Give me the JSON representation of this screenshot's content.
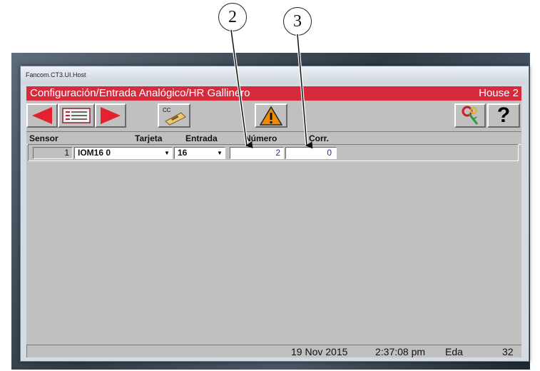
{
  "window": {
    "title": "Fancom.CT3.UI.Host"
  },
  "header": {
    "title": "Configuración/Entrada Analógico/HR Gallinero",
    "house": "House 2"
  },
  "toolbar": {
    "cc_label": "CC",
    "help_label": "?",
    "icons": [
      "arrow-left-icon",
      "list-icon",
      "arrow-right-icon",
      "cc-card-icon",
      "warning-icon",
      "keys-icon",
      "help-icon"
    ]
  },
  "table": {
    "columns": [
      "Sensor",
      "Tarjeta",
      "Entrada",
      "Número",
      "Corr."
    ],
    "rows": [
      {
        "sensor": "1",
        "tarjeta": "IOM16 0",
        "entrada": "16",
        "numero": "2",
        "corr": "0"
      }
    ]
  },
  "status": {
    "date": "19 Nov 2015",
    "time": "2:37:08 pm",
    "label": "Eda",
    "value": "32"
  },
  "callouts": [
    "2",
    "3"
  ],
  "colors": {
    "header_bar": "#d52b3d",
    "value_text": "#1f2bb3",
    "client_bg": "#c0c0c0",
    "warning": "#f08a00"
  }
}
